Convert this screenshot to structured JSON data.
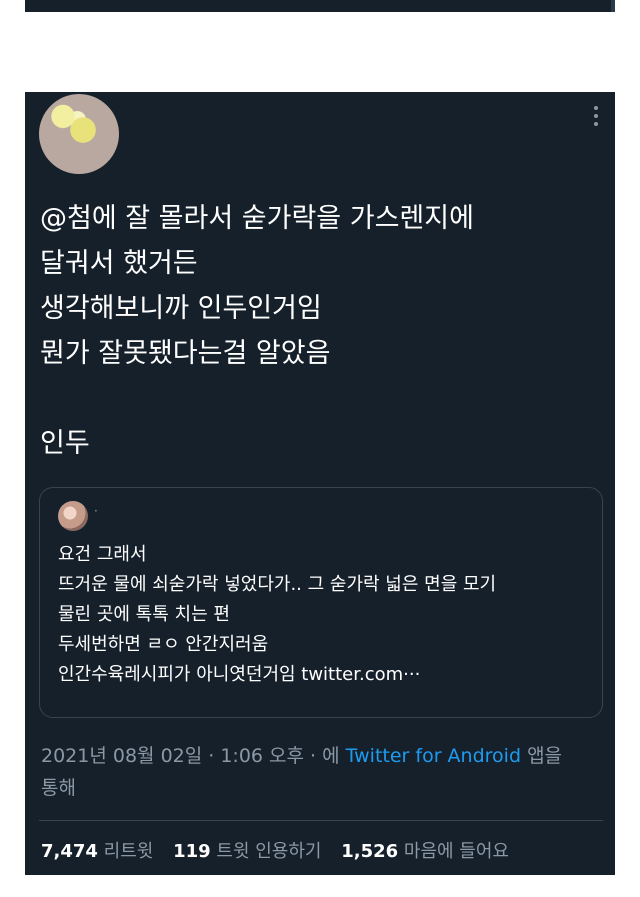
{
  "tweet": {
    "text_lines": [
      "@첨에 잘 몰라서 숟가락을 가스렌지에",
      "달궈서 했거든",
      "생각해보니까 인두인거임",
      "뭔가 잘못됐다는걸 알았음",
      "",
      "인두"
    ],
    "quoted": {
      "lines": [
        "요건 그래서",
        "뜨거운 물에 쇠숟가락 넣었다가.. 그 숟가락 넓은 면을 모기",
        "물린 곳에 톡톡 치는 편",
        "두세번하면 ㄹㅇ 안간지러움",
        "인간수육레시피가 아니엿던거임 twitter.com···"
      ]
    },
    "timestamp": "2021년 08월 02일 · 1:06 오후 · 에",
    "source": "Twitter for Android",
    "source_suffix": "앱을",
    "source_suffix2": "통해",
    "stats": {
      "retweets": "7,474",
      "retweets_label": "리트윗",
      "quotes": "119",
      "quotes_label": "트윗 인용하기",
      "likes": "1,526",
      "likes_label": "마음에 들어요"
    }
  },
  "colors": {
    "background": "#15202b",
    "border": "#38444d",
    "secondary_text": "#8b98a5",
    "link": "#1d9bf0"
  }
}
